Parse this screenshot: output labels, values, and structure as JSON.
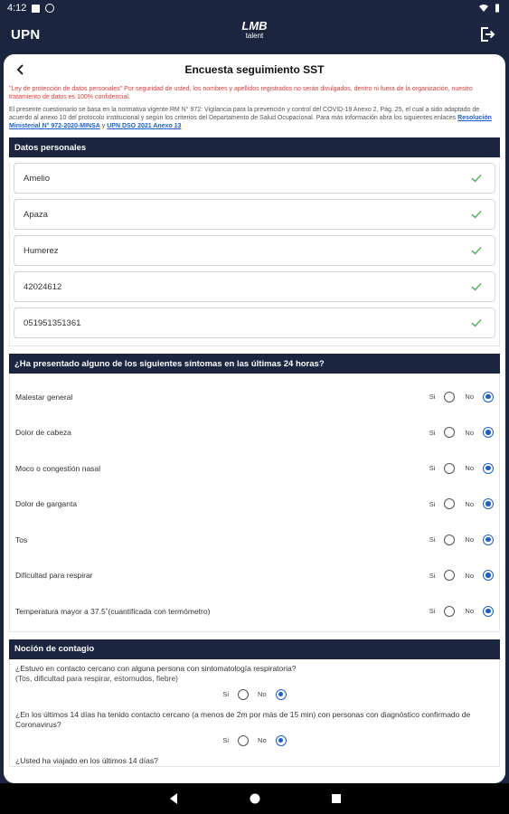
{
  "status_bar": {
    "time": "4:12"
  },
  "app_bar": {
    "title": "UPN",
    "logo_line1": "LMB",
    "logo_line2": "talent"
  },
  "card": {
    "title": "Encuesta seguimiento SST",
    "privacy_text": "\"Ley de protección de datos personales\" Por seguridad de usted, los nombres y apellidos registrados no serán divulgados, dentro ni fuera de la organización, nuestro tratamiento de datos es 100% confidencial.",
    "info_text": "El presente cuestionario se basa en la normativa vigente RM N° 972: Vigilancia para la prevención y control del COVID-19 Anexo 2, Pág. 25, el cual a sido adaptado de acuerdo al anexo 10 del protocolo institucional y según los criterios del Departamento de Salud Ocupacional. Para más información abra los siguientes enlaces",
    "link1": "Resolución Ministerial N° 972-2020-MINSA",
    "link_sep": " y ",
    "link2": "UPN DSO 2021 Anexo 13"
  },
  "personal": {
    "header": "Datos personales",
    "fields": [
      "Amelio",
      "Apaza",
      "Humerez",
      "42024612",
      "051951351361"
    ]
  },
  "symptoms": {
    "header": "¿Ha presentado alguno de los siguientes síntomas en las últimas 24 horas?",
    "yes_label": "Si",
    "no_label": "No",
    "items": [
      {
        "label": "Malestar general",
        "answer": "No"
      },
      {
        "label": "Dolor de cabeza",
        "answer": "No"
      },
      {
        "label": "Moco o congestión nasal",
        "answer": "No"
      },
      {
        "label": "Dolor de garganta",
        "answer": "No"
      },
      {
        "label": "Tos",
        "answer": "No"
      },
      {
        "label": "Dificultad para respirar",
        "answer": "No"
      },
      {
        "label": "Temperatura mayor a 37.5˚(cuantificada con termómetro)",
        "answer": "No"
      }
    ]
  },
  "contagio": {
    "header": "Noción de contagio",
    "yes_label": "Si",
    "no_label": "No",
    "q1": "¿Estuvo en contacto cercano con alguna persona con sintomatología respiratoria?",
    "q1_sub": "(Tos, dificultad para respirar, estornudos, fiebre)",
    "q1_answer": "No",
    "q2": "¿En los últimos 14 días ha tenido contacto cercano (a menos de 2m por más de 15 min) con personas con diagnóstico confirmado de Coronavirus?",
    "q2_answer": "No",
    "q3": "¿Usted ha viajado en los últimos 14 días?"
  },
  "colors": {
    "navy": "#1b2540",
    "accent": "#1e5fd0",
    "privacy_red": "#e53935",
    "check_green": "#4caf50"
  },
  "icons": [
    "back-arrow-icon",
    "logout-icon",
    "check-icon",
    "nav-back-icon",
    "nav-home-icon",
    "nav-recents-icon"
  ]
}
